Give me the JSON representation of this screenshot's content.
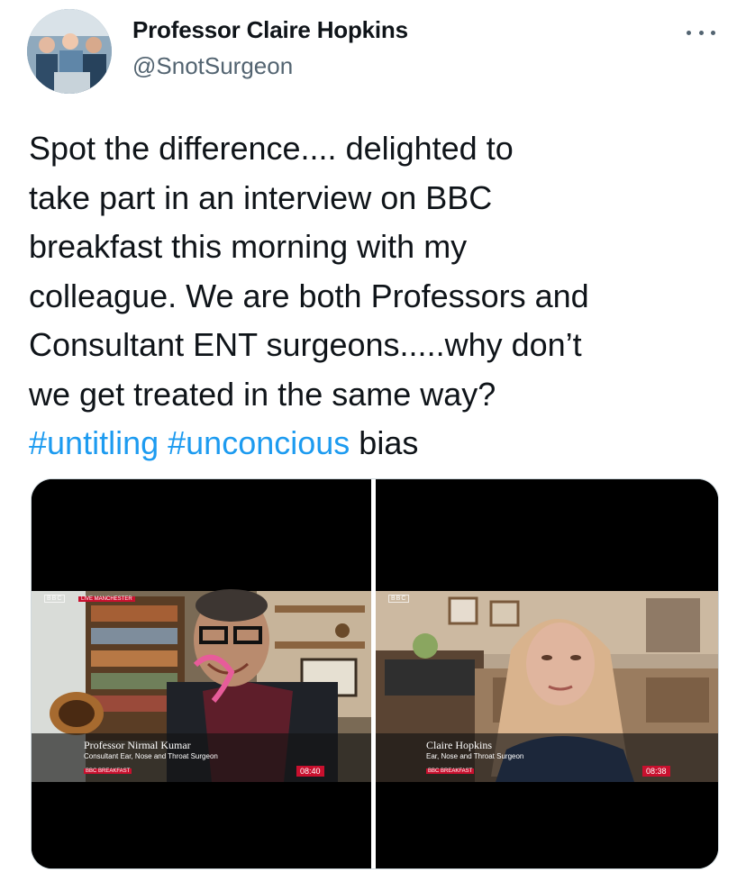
{
  "author": {
    "display_name": "Professor Claire Hopkins",
    "handle": "@SnotSurgeon",
    "avatar_icon": "profile-photo-icon"
  },
  "menu": {
    "icon": "more-options-icon"
  },
  "tweet": {
    "text": "Spot the difference.... delighted to\ntake part in an interview on BBC\nbreakfast this morning with my\ncolleague. We are both Professors and\nConsultant ENT surgeons.....why don’t\nwe get treated in the same way?\n",
    "hashtags": [
      "#untitling",
      "#unconcious"
    ],
    "tail": "bias",
    "link_color": "#1d9bf0"
  },
  "media": {
    "left": {
      "bbc_tag": "BBC",
      "live_tag": "LIVE  MANCHESTER",
      "name": "Professor Nirmal Kumar",
      "title": "Consultant Ear, Nose and Throat Surgeon",
      "brand": "BBC BREAKFAST",
      "time": "08:40"
    },
    "right": {
      "bbc_tag": "BBC",
      "name": "Claire Hopkins",
      "title": "Ear, Nose and Throat Surgeon",
      "brand": "BBC BREAKFAST",
      "time": "08:38"
    }
  }
}
